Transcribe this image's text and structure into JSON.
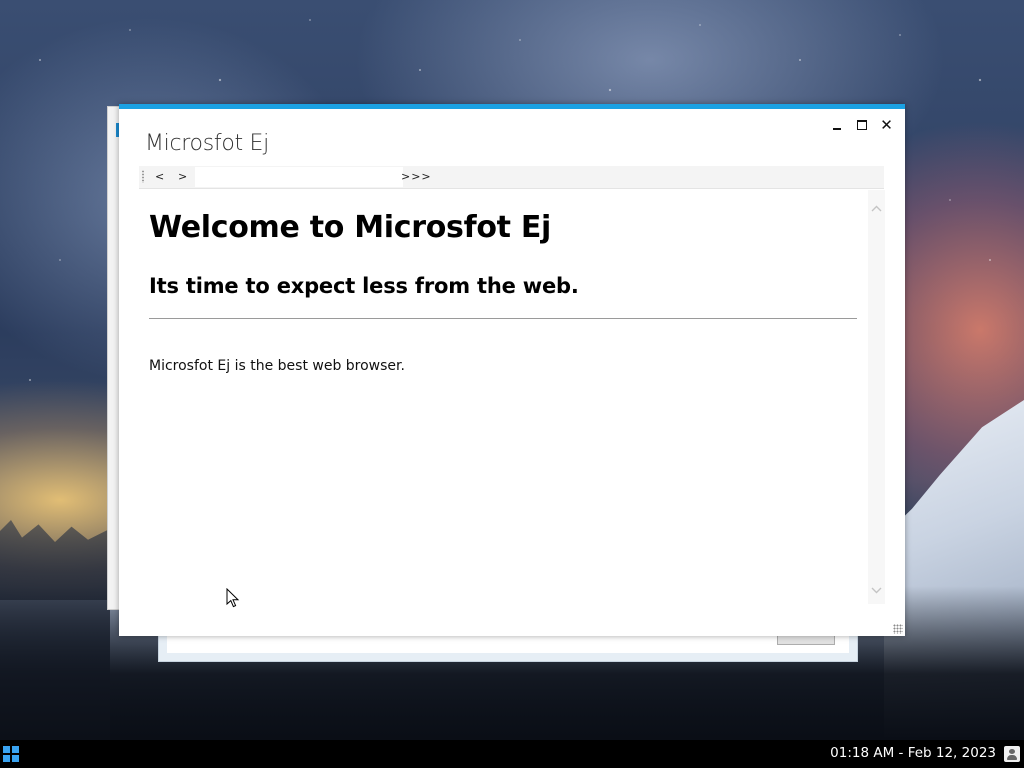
{
  "window": {
    "title": "Microsfot Ej",
    "controls": {
      "minimize": "minimize",
      "maximize": "maximize",
      "close": "✕"
    }
  },
  "toolbar": {
    "back_label": "<",
    "forward_label": ">",
    "address_value": "",
    "overflow_label": ">>>"
  },
  "page": {
    "heading": "Welcome to Microsfot Ej",
    "subheading": "Its time to expect less from the web.",
    "body": "Microsfot Ej is the best web browser."
  },
  "taskbar": {
    "clock": "01:18 AM - Feb 12, 2023"
  },
  "colors": {
    "accent": "#1ba1e2",
    "start_icon": "#3aa3f0",
    "taskbar": "#000000"
  }
}
